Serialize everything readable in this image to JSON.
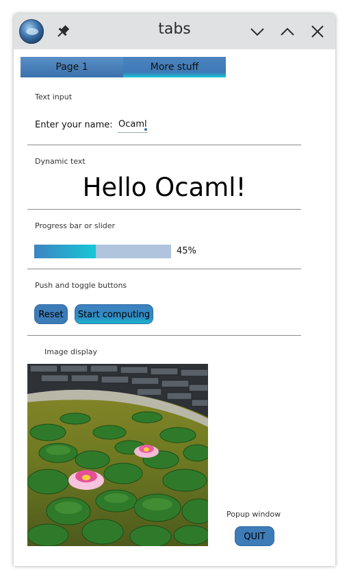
{
  "window": {
    "title": "tabs",
    "icons": {
      "app": "app-logo-icon",
      "pin": "pin-icon",
      "minimize": "chevron-down-icon",
      "maximize": "chevron-up-icon",
      "close": "close-icon"
    }
  },
  "tabs": [
    {
      "label": "Page 1",
      "active": false
    },
    {
      "label": "More stuff",
      "active": true
    }
  ],
  "text_input": {
    "section_label": "Text input",
    "field_label": "Enter your name:",
    "value": "Ocaml"
  },
  "dynamic_text": {
    "section_label": "Dynamic text",
    "greeting": "Hello Ocaml!"
  },
  "progress": {
    "section_label": "Progress bar or slider",
    "percent": 45,
    "value_label": "45%"
  },
  "buttons": {
    "section_label": "Push and toggle buttons",
    "reset_label": "Reset",
    "start_label": "Start computing"
  },
  "image": {
    "section_label": "Image display"
  },
  "popup": {
    "section_label": "Popup window",
    "quit_label": "QUIT"
  },
  "colors": {
    "accent": "#3e7cb8",
    "accent_light": "#16c7d6",
    "progress_track": "#b0c4de",
    "titlebar": "#dfe1e3"
  }
}
